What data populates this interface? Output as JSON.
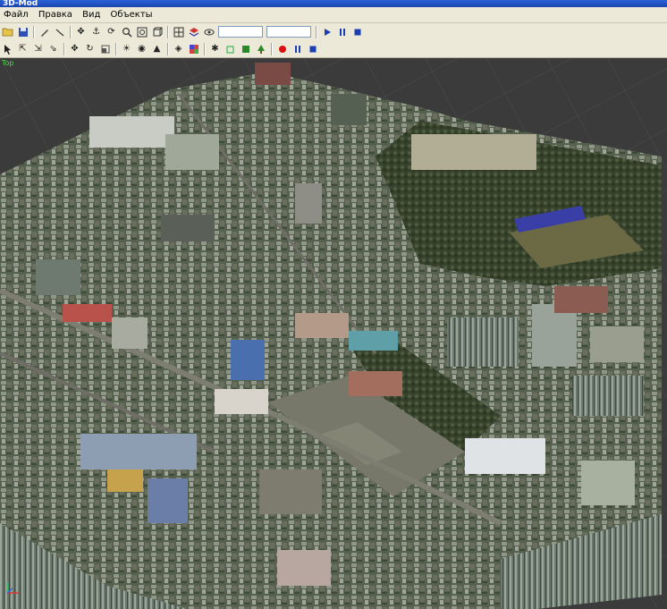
{
  "app": {
    "title": "3D-Mod"
  },
  "menu": {
    "items": [
      "Файл",
      "Правка",
      "Вид",
      "Объекты"
    ]
  },
  "toolbar1": {
    "icons": [
      "open-folder-icon",
      "save-icon",
      "pencil-icon",
      "line-tool-icon",
      "move-icon",
      "anchor-icon",
      "rotate-icon",
      "zoom-icon",
      "zoom-window-icon",
      "box-icon",
      "grid-icon",
      "layers-icon",
      "camera-icon",
      "play-icon",
      "pause-icon",
      "stop-icon"
    ],
    "input1_value": "",
    "input2_value": ""
  },
  "toolbar2": {
    "icons": [
      "select-arrow-icon",
      "select-multi-icon",
      "select-add-icon",
      "select-sub-icon",
      "move-object-icon",
      "rotate-object-icon",
      "scale-icon",
      "light-icon",
      "eye-icon",
      "terrain-icon",
      "view-icon",
      "texture-icon",
      "render-icon",
      "cube-icon",
      "green-box-icon",
      "tree-icon",
      "record-icon",
      "pause-icon",
      "stop-icon"
    ]
  },
  "viewport": {
    "label": "Top"
  },
  "colors": {
    "grid": "#4a4a4a",
    "background": "#3b3b3b",
    "park": "#3d4a30",
    "square": "#7a7a6a"
  }
}
